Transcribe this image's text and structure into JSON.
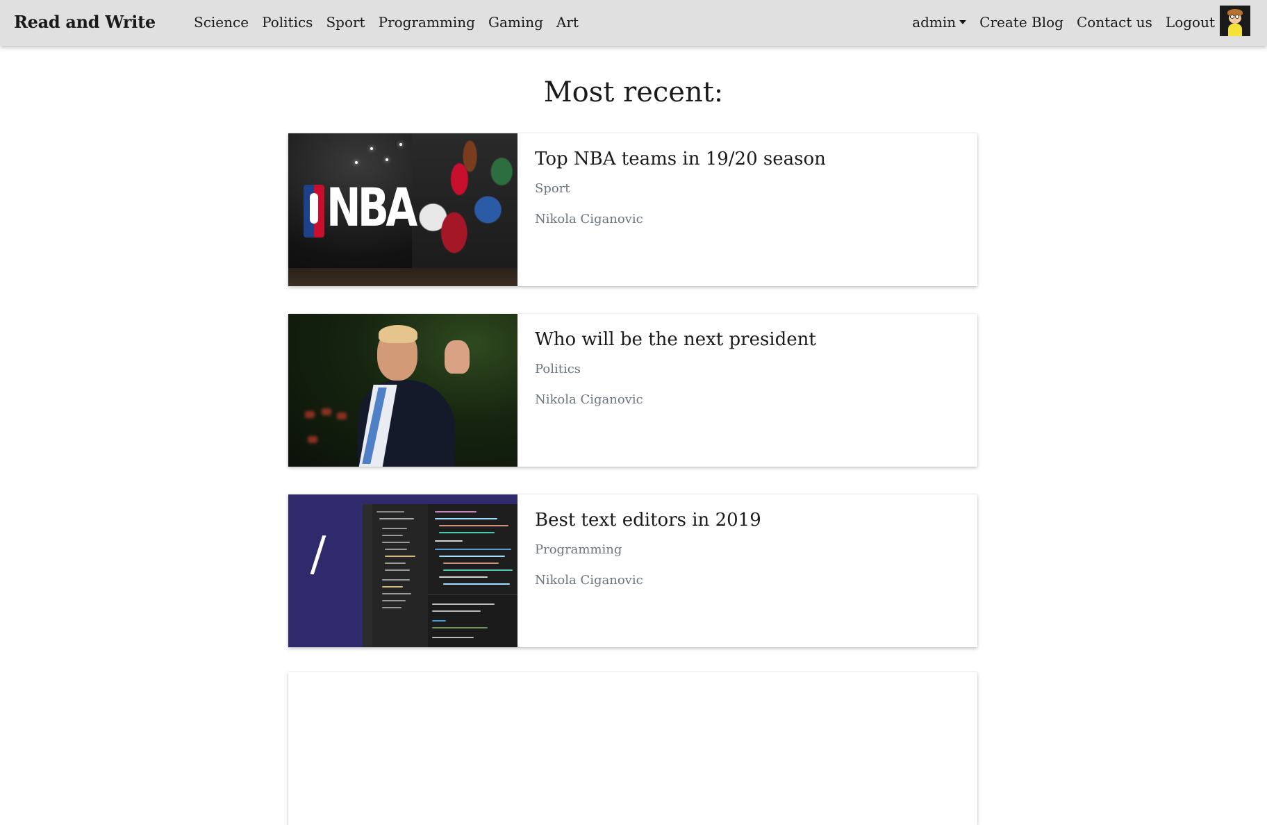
{
  "navbar": {
    "brand": "Read and Write",
    "categories": [
      "Science",
      "Politics",
      "Sport",
      "Programming",
      "Gaming",
      "Art"
    ],
    "user_menu": "admin",
    "create_blog": "Create Blog",
    "contact": "Contact us",
    "logout": "Logout",
    "avatar_icon": "user-avatar-icon"
  },
  "main": {
    "heading": "Most recent:",
    "posts": [
      {
        "title": "Top NBA teams in 19/20 season",
        "category": "Sport",
        "author": "Nikola Ciganovic",
        "thumbnail": "nba-thumbnail"
      },
      {
        "title": "Who will be the next president",
        "category": "Politics",
        "author": "Nikola Ciganovic",
        "thumbnail": "politics-thumbnail"
      },
      {
        "title": "Best text editors in 2019",
        "category": "Programming",
        "author": "Nikola Ciganovic",
        "thumbnail": "code-editor-thumbnail"
      }
    ]
  },
  "colors": {
    "navbar_bg": "#e0e0e0",
    "text_dark": "#1a1a1a",
    "text_muted": "#6c757d"
  }
}
